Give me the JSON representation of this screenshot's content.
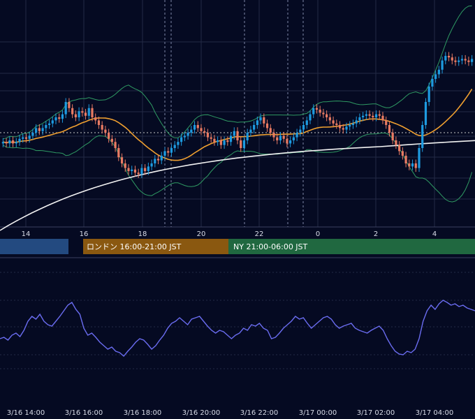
{
  "colors": {
    "background": "#050a22",
    "grid": "#232a45",
    "up_candle": "#1e9be0",
    "down_candle": "#e97b63",
    "bollinger": "#2f9a63",
    "ma_short": "#f0a030",
    "ma_long": "#f2f2f2",
    "oscillator": "#6a6cf0",
    "session_tokyo": "#234a80",
    "session_london": "#8a5810",
    "session_ny": "#206840",
    "text": "#d8dce8"
  },
  "sessions": [
    {
      "name": "tokyo",
      "label": ""
    },
    {
      "name": "london",
      "label": "ロンドン 16:00-21:00 JST"
    },
    {
      "name": "ny",
      "label": "NY 21:00-06:00 JST"
    }
  ],
  "chart_data": [
    {
      "type": "candlestick",
      "title": "",
      "x_tick_labels": [
        "14",
        "16",
        "18",
        "20",
        "22",
        "0",
        "2",
        "4"
      ],
      "y_tick_labels": [],
      "grid": true,
      "current_price_line": true,
      "overlays": [
        "bollinger upper",
        "bollinger lower",
        "short moving average",
        "long moving average"
      ],
      "candles_close_approx": [
        0.44,
        0.43,
        0.45,
        0.43,
        0.44,
        0.46,
        0.47,
        0.46,
        0.48,
        0.5,
        0.53,
        0.51,
        0.53,
        0.55,
        0.56,
        0.58,
        0.6,
        0.59,
        0.62,
        0.7,
        0.66,
        0.62,
        0.6,
        0.64,
        0.63,
        0.61,
        0.66,
        0.6,
        0.58,
        0.55,
        0.52,
        0.5,
        0.46,
        0.44,
        0.4,
        0.34,
        0.3,
        0.27,
        0.25,
        0.26,
        0.24,
        0.23,
        0.27,
        0.25,
        0.28,
        0.3,
        0.33,
        0.32,
        0.35,
        0.38,
        0.37,
        0.4,
        0.42,
        0.44,
        0.47,
        0.48,
        0.5,
        0.52,
        0.55,
        0.53,
        0.51,
        0.5,
        0.47,
        0.46,
        0.44,
        0.45,
        0.42,
        0.45,
        0.44,
        0.48,
        0.51,
        0.45,
        0.4,
        0.45,
        0.5,
        0.52,
        0.55,
        0.58,
        0.6,
        0.56,
        0.53,
        0.5,
        0.47,
        0.45,
        0.48,
        0.46,
        0.43,
        0.45,
        0.47,
        0.5,
        0.52,
        0.55,
        0.58,
        0.62,
        0.66,
        0.65,
        0.63,
        0.62,
        0.6,
        0.58,
        0.56,
        0.55,
        0.53,
        0.52,
        0.54,
        0.55,
        0.56,
        0.58,
        0.6,
        0.61,
        0.62,
        0.61,
        0.6,
        0.62,
        0.61,
        0.58,
        0.55,
        0.5,
        0.45,
        0.42,
        0.38,
        0.35,
        0.3,
        0.28,
        0.3,
        0.27,
        0.4,
        0.55,
        0.7,
        0.8,
        0.85,
        0.88,
        0.91,
        0.97,
        1.0,
        0.99,
        0.97,
        0.96,
        0.97,
        0.98,
        0.97,
        0.96,
        0.98
      ]
    },
    {
      "type": "line",
      "title": "",
      "x_tick_labels": [
        "3/16 14:00",
        "3/16 16:00",
        "3/16 18:00",
        "3/16 20:00",
        "3/16 22:00",
        "3/17 00:00",
        "3/17 02:00",
        "3/17 04:00"
      ],
      "grid": true,
      "series": [
        {
          "values": [
            0.3,
            0.32,
            0.28,
            0.35,
            0.38,
            0.33,
            0.42,
            0.55,
            0.62,
            0.58,
            0.65,
            0.55,
            0.5,
            0.48,
            0.55,
            0.62,
            0.7,
            0.78,
            0.82,
            0.72,
            0.65,
            0.45,
            0.35,
            0.38,
            0.32,
            0.25,
            0.2,
            0.15,
            0.18,
            0.12,
            0.1,
            0.05,
            0.12,
            0.18,
            0.25,
            0.3,
            0.28,
            0.22,
            0.15,
            0.2,
            0.28,
            0.35,
            0.45,
            0.52,
            0.55,
            0.6,
            0.55,
            0.5,
            0.58,
            0.6,
            0.62,
            0.55,
            0.48,
            0.42,
            0.38,
            0.42,
            0.4,
            0.35,
            0.3,
            0.35,
            0.38,
            0.45,
            0.42,
            0.5,
            0.48,
            0.52,
            0.45,
            0.42,
            0.3,
            0.32,
            0.38,
            0.45,
            0.5,
            0.55,
            0.62,
            0.58,
            0.6,
            0.52,
            0.45,
            0.5,
            0.55,
            0.6,
            0.62,
            0.58,
            0.5,
            0.45,
            0.48,
            0.5,
            0.52,
            0.45,
            0.42,
            0.4,
            0.38,
            0.42,
            0.45,
            0.48,
            0.42,
            0.3,
            0.2,
            0.12,
            0.08,
            0.07,
            0.12,
            0.1,
            0.15,
            0.3,
            0.55,
            0.7,
            0.78,
            0.72,
            0.8,
            0.85,
            0.82,
            0.78,
            0.8,
            0.76,
            0.78,
            0.74,
            0.72,
            0.7
          ]
        }
      ]
    }
  ]
}
